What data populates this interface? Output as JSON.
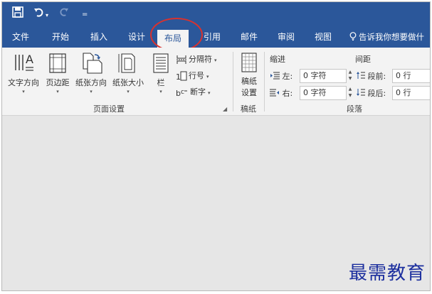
{
  "quick_access": {
    "save_icon": "save-icon",
    "undo_icon": "undo-icon",
    "undo_dropdown": "▾",
    "redo_icon": "redo-icon",
    "customize_label": "="
  },
  "tabs": [
    {
      "label": "文件"
    },
    {
      "label": "开始"
    },
    {
      "label": "插入"
    },
    {
      "label": "设计"
    },
    {
      "label": "布局",
      "active": true
    },
    {
      "label": "引用"
    },
    {
      "label": "邮件"
    },
    {
      "label": "审阅"
    },
    {
      "label": "视图"
    }
  ],
  "tell_me": {
    "icon": "lightbulb-icon",
    "label": "告诉我你想要做什"
  },
  "ribbon": {
    "page_setup": {
      "group_label": "页面设置",
      "text_direction": "文字方向",
      "margins": "页边距",
      "orientation": "纸张方向",
      "size": "纸张大小",
      "columns": "栏",
      "breaks": "分隔符",
      "line_numbers": "行号",
      "hyphenation": "断字"
    },
    "manuscript": {
      "group_label": "稿纸",
      "button_line1": "稿纸",
      "button_line2": "设置"
    },
    "paragraph": {
      "group_label": "段落",
      "indent_title": "缩进",
      "spacing_title": "间距",
      "indent_left_label": "左:",
      "indent_left_value": "0 字符",
      "indent_right_label": "右:",
      "indent_right_value": "0 字符",
      "spacing_before_label": "段前:",
      "spacing_before_value": "0 行",
      "spacing_after_label": "段后:",
      "spacing_after_value": "0 行"
    }
  },
  "watermark": "最需教育",
  "colors": {
    "title_bar": "#2b579a",
    "ribbon_bg": "#f3f3f3",
    "doc_bg": "#e6e6e6",
    "highlight": "#d9322e",
    "watermark": "#1c2f9e"
  }
}
